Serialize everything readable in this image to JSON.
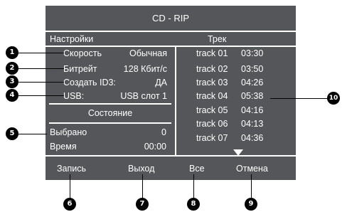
{
  "title": "CD - RIP",
  "settings": {
    "header": "Настройки",
    "rows": [
      {
        "label": "Скорость",
        "value": "Обычная"
      },
      {
        "label": "Битрейт",
        "value": "128 Кбит/с"
      },
      {
        "label": "Создать ID3:",
        "value": "ДА"
      },
      {
        "label": "USB:",
        "value": "USB слот 1"
      }
    ]
  },
  "status": {
    "header": "Состояние",
    "rows": [
      {
        "label": "Выбрано",
        "value": "0"
      },
      {
        "label": "Время",
        "value": "00:00"
      }
    ]
  },
  "tracks": {
    "header": "Трек",
    "items": [
      {
        "name": "track 01",
        "time": "03:30"
      },
      {
        "name": "track 02",
        "time": "03:50"
      },
      {
        "name": "track 03",
        "time": "04:26"
      },
      {
        "name": "track 04",
        "time": "05:38"
      },
      {
        "name": "track 05",
        "time": "04:16"
      },
      {
        "name": "track 06",
        "time": "04:13"
      },
      {
        "name": "track 07",
        "time": "04:36"
      }
    ]
  },
  "buttons": {
    "record": "Запись",
    "exit": "Выход",
    "all": "Все",
    "cancel": "Отмена"
  },
  "callouts": [
    "1",
    "2",
    "3",
    "4",
    "5",
    "6",
    "7",
    "8",
    "9",
    "10"
  ],
  "colors": {
    "screen_bg": "#555659",
    "text": "#ffffff",
    "callout": "#000000"
  }
}
